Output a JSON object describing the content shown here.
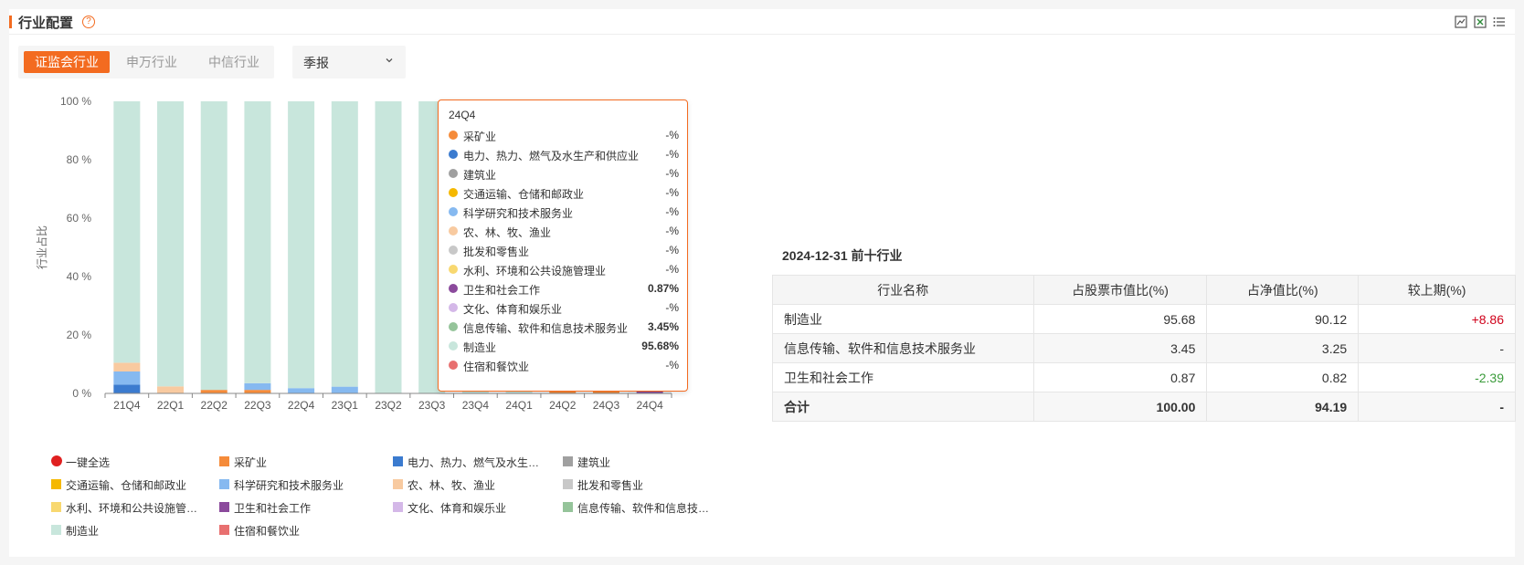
{
  "header": {
    "title": "行业配置",
    "help": "?"
  },
  "tabs": [
    {
      "label": "证监会行业",
      "active": true
    },
    {
      "label": "申万行业",
      "active": false
    },
    {
      "label": "中信行业",
      "active": false
    }
  ],
  "period_select": {
    "value": "季报"
  },
  "colors": {
    "accent": "#f36b20"
  },
  "chart_data": {
    "type": "bar",
    "stacked": true,
    "ylabel": "行业占比",
    "ylim": [
      0,
      100
    ],
    "yticks": [
      "0 %",
      "20 %",
      "40 %",
      "60 %",
      "80 %",
      "100 %"
    ],
    "categories": [
      "21Q4",
      "22Q1",
      "22Q2",
      "22Q3",
      "22Q4",
      "23Q1",
      "23Q2",
      "23Q3",
      "23Q4",
      "24Q1",
      "24Q2",
      "24Q3",
      "24Q4"
    ],
    "series": [
      {
        "name": "采矿业",
        "color": "#f58b3a",
        "values": [
          0,
          0,
          1.2,
          1.2,
          0,
          0,
          0,
          0,
          0,
          0,
          6.5,
          5.5,
          0
        ]
      },
      {
        "name": "电力、热力、燃气及水生产和供应业",
        "color": "#3b7bcf",
        "values": [
          3,
          0,
          0,
          0,
          0,
          0,
          0,
          0,
          0,
          0,
          0,
          0,
          0
        ]
      },
      {
        "name": "建筑业",
        "color": "#a0a0a0",
        "values": [
          0,
          0,
          0,
          0,
          0,
          0,
          0,
          0,
          0,
          0,
          0,
          0,
          0
        ]
      },
      {
        "name": "交通运输、仓储和邮政业",
        "color": "#f5b800",
        "values": [
          0,
          0,
          0,
          0,
          0,
          0,
          0,
          0,
          0,
          0,
          0,
          3,
          0
        ]
      },
      {
        "name": "科学研究和技术服务业",
        "color": "#86b9f0",
        "values": [
          4.5,
          0,
          0,
          2.3,
          1.8,
          2.3,
          0,
          0,
          0,
          0,
          0,
          1.5,
          0
        ]
      },
      {
        "name": "农、林、牧、渔业",
        "color": "#f8caa0",
        "values": [
          3,
          2.4,
          0,
          0,
          0,
          0,
          0,
          0,
          0,
          0,
          0,
          0,
          0
        ]
      },
      {
        "name": "批发和零售业",
        "color": "#c8c8c8",
        "values": [
          0,
          0,
          0,
          0,
          0,
          0,
          0,
          0,
          0,
          0,
          0,
          0,
          0
        ]
      },
      {
        "name": "水利、环境和公共设施管理业",
        "color": "#f8d870",
        "values": [
          0,
          0,
          0,
          0,
          0,
          0,
          0,
          0,
          0,
          0,
          0,
          0,
          0
        ]
      },
      {
        "name": "卫生和社会工作",
        "color": "#8b4a9c",
        "values": [
          0,
          0,
          0,
          0,
          0,
          0,
          0,
          0,
          0,
          0,
          0,
          1.3,
          0.87
        ]
      },
      {
        "name": "文化、体育和娱乐业",
        "color": "#d4b8e8",
        "values": [
          0,
          0,
          0,
          0,
          0,
          0,
          0,
          0,
          0,
          0,
          0,
          0,
          0
        ]
      },
      {
        "name": "信息传输、软件和信息技术服务业",
        "color": "#95c49a",
        "values": [
          0,
          0,
          0,
          0,
          0,
          0,
          0,
          0,
          0,
          0,
          0,
          0,
          3.45
        ]
      },
      {
        "name": "制造业",
        "color": "#c8e6dc",
        "values": [
          89.5,
          97.6,
          98.8,
          96.5,
          98.2,
          97.7,
          100,
          100,
          100,
          100,
          93.5,
          87.7,
          95.68
        ]
      },
      {
        "name": "住宿和餐饮业",
        "color": "#e87070",
        "values": [
          0,
          0,
          0,
          0,
          0,
          0,
          0,
          0,
          0,
          0,
          0,
          0,
          0
        ]
      }
    ],
    "highlighted_category": "24Q4"
  },
  "legend": {
    "select_all": "一键全选",
    "select_all_color": "#e02020",
    "items": [
      "采矿业",
      "电力、热力、燃气及水生产...",
      "建筑业",
      "交通运输、仓储和邮政业",
      "科学研究和技术服务业",
      "农、林、牧、渔业",
      "批发和零售业",
      "水利、环境和公共设施管理业",
      "卫生和社会工作",
      "文化、体育和娱乐业",
      "信息传输、软件和信息技术...",
      "制造业",
      "住宿和餐饮业"
    ]
  },
  "tooltip": {
    "title": "24Q4",
    "rows": [
      {
        "name": "采矿业",
        "value": "-%"
      },
      {
        "name": "电力、热力、燃气及水生产和供应业",
        "value": "-%"
      },
      {
        "name": "建筑业",
        "value": "-%"
      },
      {
        "name": "交通运输、仓储和邮政业",
        "value": "-%"
      },
      {
        "name": "科学研究和技术服务业",
        "value": "-%"
      },
      {
        "name": "农、林、牧、渔业",
        "value": "-%"
      },
      {
        "name": "批发和零售业",
        "value": "-%"
      },
      {
        "name": "水利、环境和公共设施管理业",
        "value": "-%"
      },
      {
        "name": "卫生和社会工作",
        "value": "0.87%"
      },
      {
        "name": "文化、体育和娱乐业",
        "value": "-%"
      },
      {
        "name": "信息传输、软件和信息技术服务业",
        "value": "3.45%"
      },
      {
        "name": "制造业",
        "value": "95.68%"
      },
      {
        "name": "住宿和餐饮业",
        "value": "-%"
      }
    ]
  },
  "top_table": {
    "title": "2024-12-31 前十行业",
    "headers": [
      "行业名称",
      "占股票市值比(%)",
      "占净值比(%)",
      "较上期(%)"
    ],
    "rows": [
      [
        "制造业",
        "95.68",
        "90.12",
        "+8.86"
      ],
      [
        "信息传输、软件和信息技术服务业",
        "3.45",
        "3.25",
        "-"
      ],
      [
        "卫生和社会工作",
        "0.87",
        "0.82",
        "-2.39"
      ]
    ],
    "total": [
      "合计",
      "100.00",
      "94.19",
      "-"
    ]
  }
}
